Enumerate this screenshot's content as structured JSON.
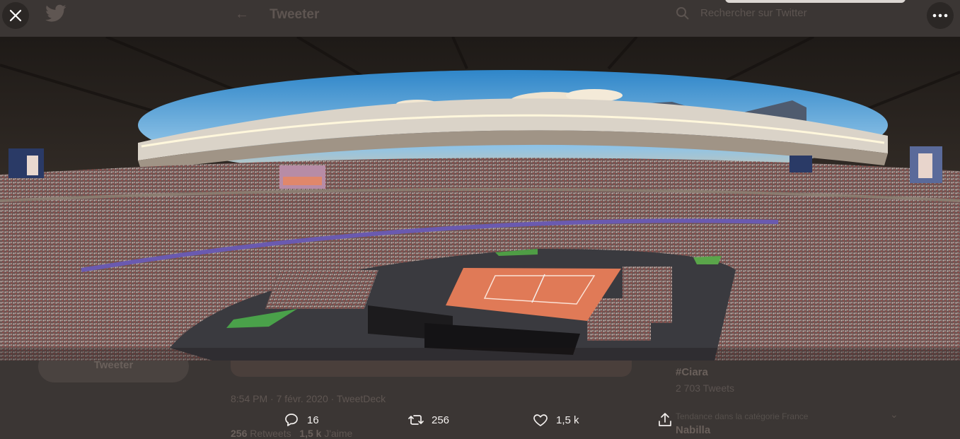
{
  "background_page": {
    "header_title": "Tweeter",
    "search_placeholder": "Rechercher sur Twitter",
    "tweet_button_label": "Tweeter",
    "tweet_meta": "8:54 PM · 7 févr. 2020 · TweetDeck",
    "stats": {
      "retweets_count": "256",
      "retweets_label": "Retweets",
      "likes_count": "1,5 k",
      "likes_label": "J'aime"
    },
    "trends": [
      {
        "name": "#Ciara",
        "count": "2 703 Tweets"
      },
      {
        "meta": "Tendance dans la catégorie France",
        "name": "Nabilla"
      }
    ]
  },
  "viewer": {
    "close_icon": "close-icon",
    "more_icon": "more-horizontal-icon"
  },
  "image": {
    "description_icon": "stadium-photo"
  },
  "actions": {
    "reply_count": "16",
    "retweet_count": "256",
    "like_count": "1,5 k",
    "share_icon": "share-icon"
  },
  "colors": {
    "overlay_bg": "#3b3634",
    "action_text": "#f3f0ee",
    "court": "#e07a57"
  }
}
